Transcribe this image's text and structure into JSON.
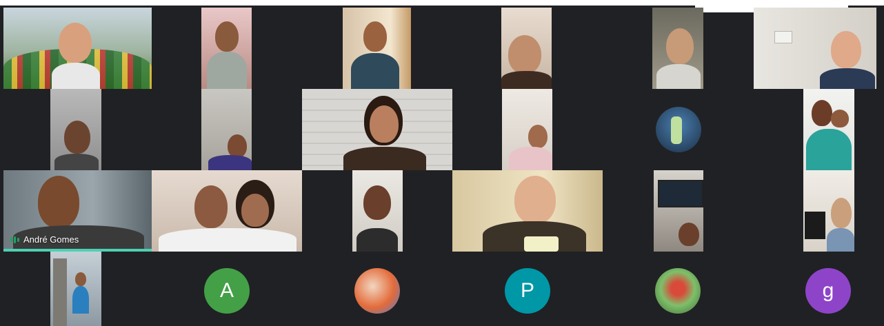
{
  "participants": {
    "active_speaker": {
      "name": "André Gomes"
    },
    "avatars": [
      {
        "initial": "A",
        "color": "#43a047"
      },
      {
        "initial": "P",
        "color": "#0097a7"
      },
      {
        "initial": "g",
        "color": "#8e44c8"
      }
    ]
  },
  "colors": {
    "background": "#202124",
    "speaking_indicator": "#4dd0b4"
  }
}
